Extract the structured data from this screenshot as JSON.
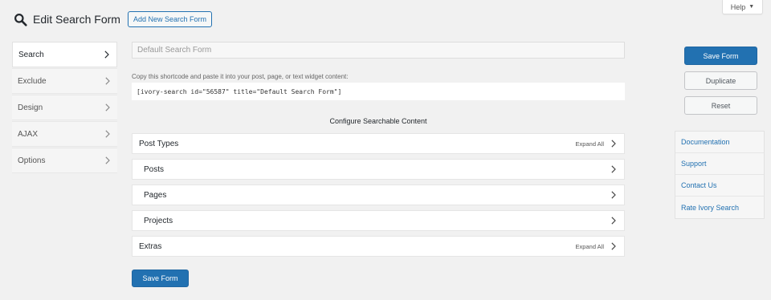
{
  "help_tab": {
    "label": "Help",
    "caret": "▼"
  },
  "header": {
    "title": "Edit Search Form",
    "add_new_label": "Add New Search Form"
  },
  "tabs": [
    {
      "label": "Search"
    },
    {
      "label": "Exclude"
    },
    {
      "label": "Design"
    },
    {
      "label": "AJAX"
    },
    {
      "label": "Options"
    }
  ],
  "form": {
    "title_placeholder": "Default Search Form",
    "shortcode_label": "Copy this shortcode and paste it into your post, page, or text widget content:",
    "shortcode_value": "[ivory-search id=\"56587\" title=\"Default Search Form\"]",
    "section_heading": "Configure Searchable Content",
    "expand_all_label": "Expand All",
    "accordion": {
      "post_types": "Post Types",
      "posts": "Posts",
      "pages": "Pages",
      "projects": "Projects",
      "extras": "Extras"
    },
    "save_label": "Save Form"
  },
  "sidebar": {
    "save_label": "Save Form",
    "duplicate_label": "Duplicate",
    "reset_label": "Reset",
    "links": [
      "Documentation",
      "Support",
      "Contact Us",
      "Rate Ivory Search"
    ]
  },
  "colors": {
    "accent": "#2271b1",
    "background": "#f1f1f1"
  },
  "icons": {
    "title": "search-icon",
    "tab": "chevron-right-icon",
    "help": "caret-down-icon"
  }
}
